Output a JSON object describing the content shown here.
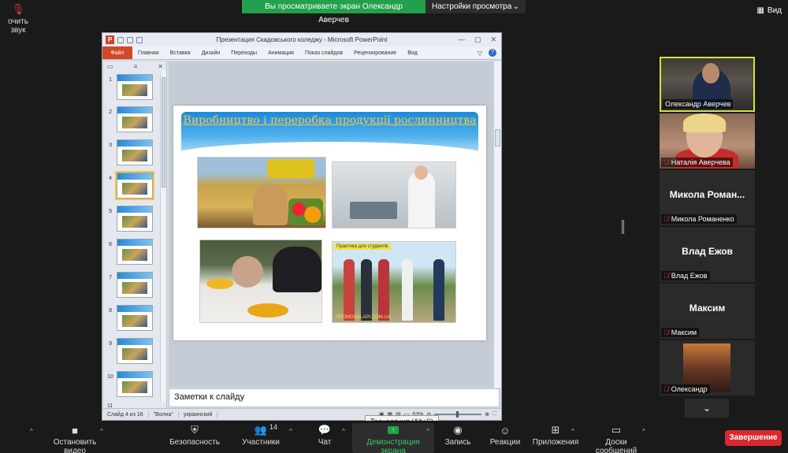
{
  "banner": {
    "viewing_text": "Вы просматриваете экран Олександр Аверчев",
    "view_settings": "Настройки просмотра"
  },
  "view_button": "Вид",
  "ppt": {
    "window_title": "Презентация Скадовського коледжу  -  Microsoft PowerPoint",
    "file_tab": "Файл",
    "tabs": [
      "Главная",
      "Вставка",
      "Дизайн",
      "Переходы",
      "Анимация",
      "Показ слайдов",
      "Рецензирование",
      "Вид"
    ],
    "thumb_numbers": [
      "1",
      "2",
      "3",
      "4",
      "5",
      "6",
      "7",
      "8",
      "9",
      "10",
      "11"
    ],
    "active_slide": 4,
    "slide_title": "Виробництво і переробка продукції рослинництва",
    "photo4_tag": "Практика для студентів",
    "photo4_site": "PROMOSHLAPI.COM.UA",
    "notes_placeholder": "Заметки к слайду",
    "status": {
      "slide": "Слайд 4 из 16",
      "theme": "\"Волна\"",
      "lang": "украинский",
      "zoom": "63%"
    }
  },
  "tooltip": "Трансляция (Alt+S)",
  "participants": [
    {
      "name": "Олександр Аверчев",
      "muted": false,
      "video": true
    },
    {
      "name": "Наталія Аверчева",
      "muted": true,
      "video": true
    },
    {
      "name": "Микола Романенко",
      "short": "Микола  Роман...",
      "muted": true,
      "video": false
    },
    {
      "name": "Влад Ежов",
      "short": "Влад Ежов",
      "muted": true,
      "video": false
    },
    {
      "name": "Максим",
      "short": "Максим",
      "muted": true,
      "video": false
    },
    {
      "name": "Олександр",
      "muted": true,
      "video": false
    }
  ],
  "toolbar": {
    "unmute": "очить звук",
    "stop_video": "Остановить видео",
    "security": "Безопасность",
    "participants": "Участники",
    "participants_count": "14",
    "chat": "Чат",
    "share": "Демонстрация экрана",
    "record": "Запись",
    "reactions": "Реакции",
    "apps": "Приложения",
    "whiteboards": "Доски сообщений",
    "end": "Завершение"
  },
  "colors": {
    "share_green": "#23a04b",
    "end_red": "#d9282f",
    "active_speaker": "#d6e13a"
  }
}
